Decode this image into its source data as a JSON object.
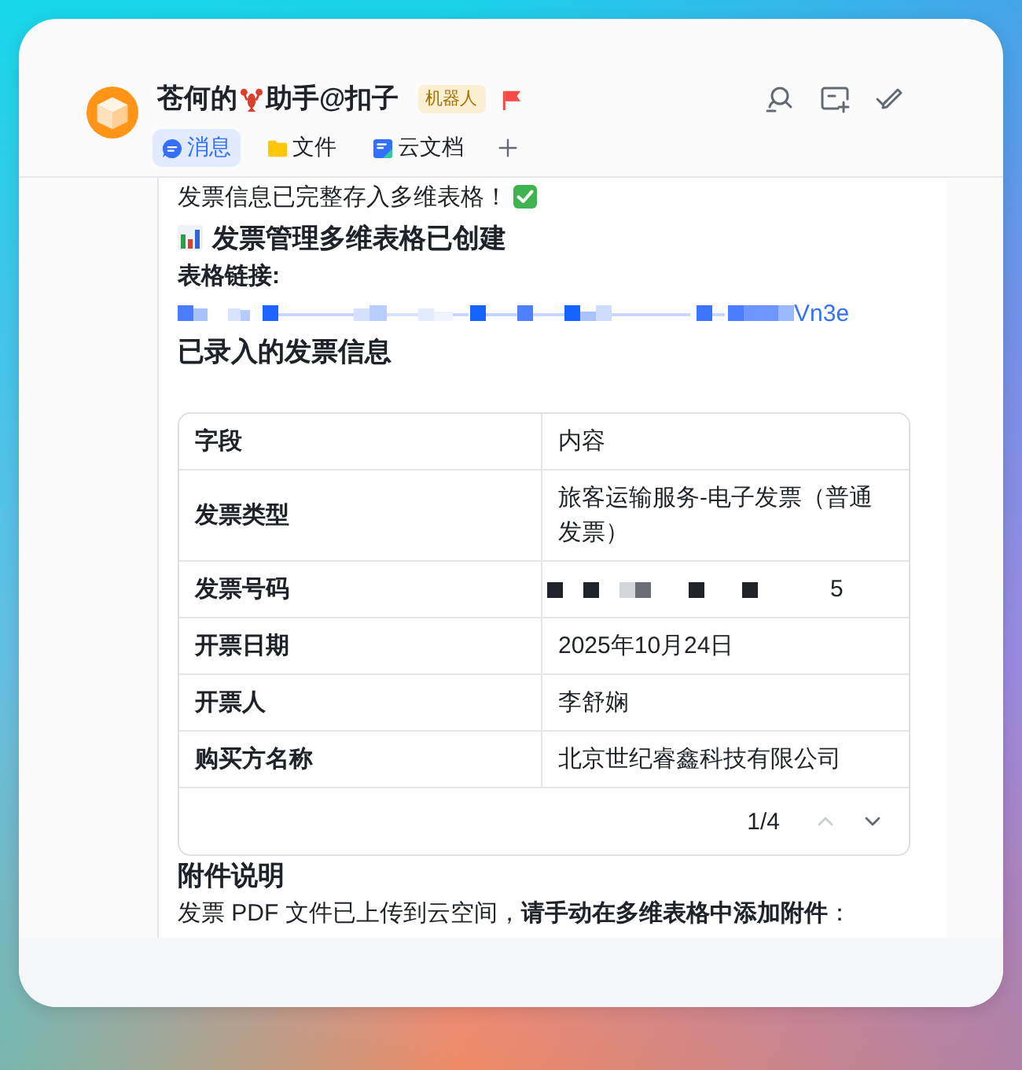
{
  "chat": {
    "title_start": "苍何的",
    "title_end": "助手@扣子",
    "badge": "机器人",
    "flagged": true
  },
  "tabs": [
    {
      "label": "消息",
      "selected": true
    },
    {
      "label": "文件",
      "selected": false
    },
    {
      "label": "云文档",
      "selected": false
    }
  ],
  "message": {
    "status": "发票信息已完整存入多维表格！",
    "status_done": true,
    "heading": "发票管理多维表格已创建",
    "link_label": "表格链接:",
    "link": {
      "text": "Vn3e",
      "redacted": true
    },
    "section_title": "已录入的发票信息",
    "table": {
      "columns": [
        "字段",
        "内容"
      ],
      "rows": [
        {
          "field": "发票类型",
          "value": "旅客运输服务-电子发票（普通发票）",
          "redacted": false
        },
        {
          "field": "发票号码",
          "value": "5",
          "redacted": true
        },
        {
          "field": "开票日期",
          "value": "2025年10月24日",
          "redacted": false
        },
        {
          "field": "开票人",
          "value": "李舒娴",
          "redacted": false
        },
        {
          "field": "购买方名称",
          "value": "北京世纪睿鑫科技有限公司",
          "redacted": false
        }
      ],
      "pager": {
        "page": "1/4",
        "prev_disabled": true,
        "next_disabled": false
      }
    },
    "attachment_title": "附件说明",
    "attachment_text": "发票 PDF 文件已上传到云空间，**请手动在多维表格中添加附件**："
  }
}
